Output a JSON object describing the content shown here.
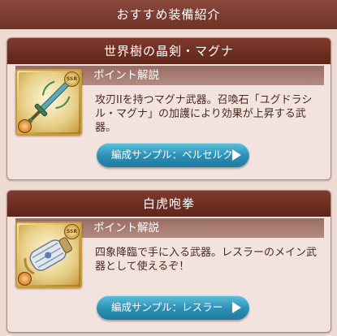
{
  "section": {
    "title": "おすすめ装備紹介"
  },
  "cards": [
    {
      "title": "世界樹の晶剣・マグナ",
      "subheader": "ポイント解説",
      "rarity": "SSR",
      "icon": "sword-icon",
      "description": "攻刃IIを持つマグナ武器。召喚石「ユグドラシル・マグナ」の加護により効果が上昇する武器。",
      "button_label": "編成サンプル：ベルセルク"
    },
    {
      "title": "白虎咆拳",
      "subheader": "ポイント解説",
      "rarity": "SSR",
      "icon": "gauntlet-icon",
      "description": "四象降臨で手に入る武器。レスラーのメイン武器として使えるぞ！",
      "button_label": "編成サンプル：レスラー"
    }
  ],
  "colors": {
    "header": "#6e3226",
    "card_title": "#5f2519",
    "subheader": "#a57a70",
    "button": "#2b8fb5",
    "background": "#eddad3",
    "text": "#4a2a20"
  }
}
